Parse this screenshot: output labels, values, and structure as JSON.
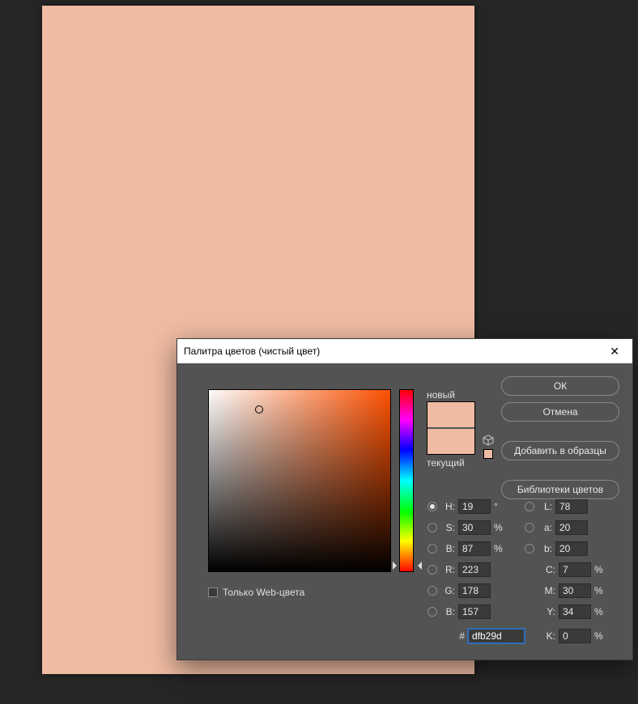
{
  "canvas": {
    "color": "#efbba2"
  },
  "dialog": {
    "title": "Палитра цветов (чистый цвет)",
    "close_glyph": "✕",
    "buttons": {
      "ok": "ОК",
      "cancel": "Отмена",
      "add_swatch": "Добавить в образцы",
      "libraries": "Библиотеки цветов"
    },
    "swatch": {
      "new_label": "новый",
      "current_label": "текущий",
      "new_color": "#efbba2",
      "current_color": "#efbba2"
    },
    "web_only_label": "Только Web-цвета",
    "fields": {
      "H": {
        "label": "H:",
        "value": "19",
        "unit": "°"
      },
      "S": {
        "label": "S:",
        "value": "30",
        "unit": "%"
      },
      "Bv": {
        "label": "B:",
        "value": "87",
        "unit": "%"
      },
      "R": {
        "label": "R:",
        "value": "223",
        "unit": ""
      },
      "G": {
        "label": "G:",
        "value": "178",
        "unit": ""
      },
      "Bc": {
        "label": "B:",
        "value": "157",
        "unit": ""
      },
      "L": {
        "label": "L:",
        "value": "78",
        "unit": ""
      },
      "a": {
        "label": "a:",
        "value": "20",
        "unit": ""
      },
      "b": {
        "label": "b:",
        "value": "20",
        "unit": ""
      },
      "C": {
        "label": "C:",
        "value": "7",
        "unit": "%"
      },
      "M": {
        "label": "M:",
        "value": "30",
        "unit": "%"
      },
      "Y": {
        "label": "Y:",
        "value": "34",
        "unit": "%"
      },
      "K": {
        "label": "K:",
        "value": "0",
        "unit": "%"
      },
      "hash": "#",
      "hex": "dfb29d"
    }
  }
}
